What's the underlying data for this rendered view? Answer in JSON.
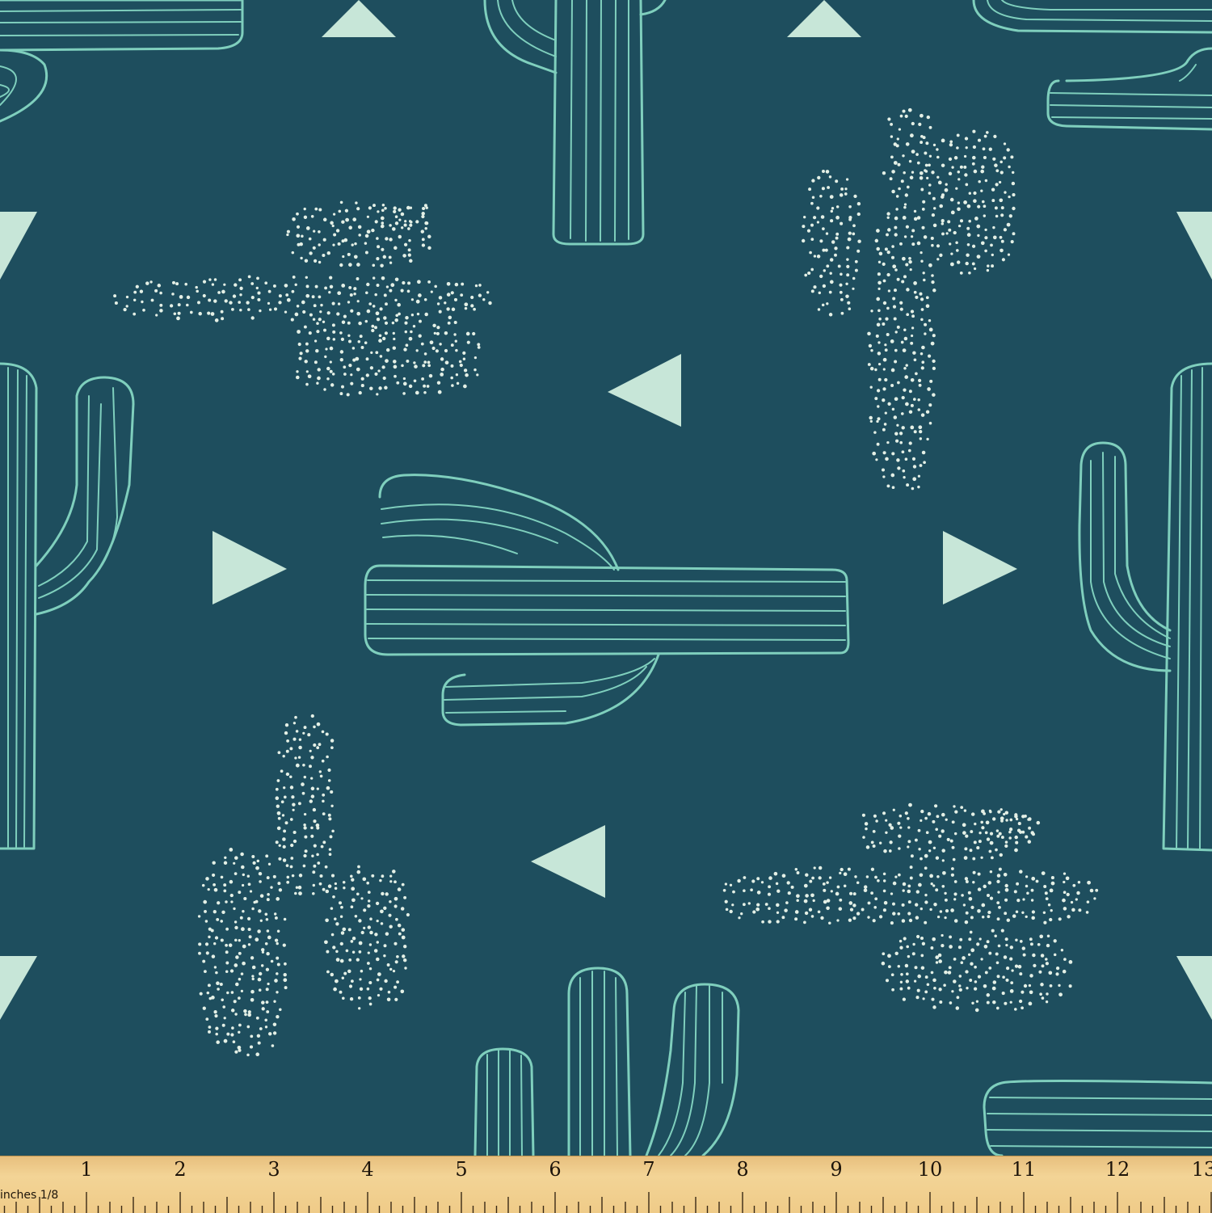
{
  "colors": {
    "background": "#1e4e5e",
    "outline": "#7fcfbd",
    "triangle": "#c7e6d8",
    "dots": "#e4f0e6",
    "ruler": "#f0cf8e"
  },
  "pattern": {
    "motifs": [
      "outlined-cactus",
      "dotted-cactus",
      "triangle"
    ]
  },
  "ruler": {
    "unit_label": "inches 1/8",
    "numbers": [
      "1",
      "2",
      "3",
      "4",
      "5",
      "6",
      "7",
      "8",
      "9",
      "10",
      "11",
      "12",
      "13"
    ]
  }
}
